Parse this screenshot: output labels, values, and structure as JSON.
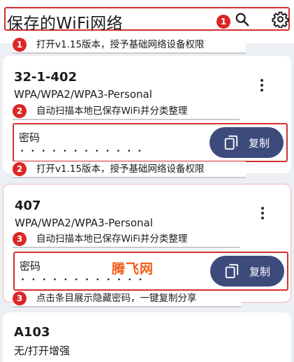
{
  "header": {
    "title": "保存的WiFi网络",
    "badge": "1",
    "search_icon": "search-icon",
    "settings_icon": "gear-icon"
  },
  "notes": [
    {
      "badge": "1",
      "text": "打开v1.15版本，授予基础网络设备权限"
    },
    {
      "badge": "2",
      "text": "自动扫描本地已保存WiFi并分类整理"
    },
    {
      "badge": "2",
      "text": "打开v1.15版本，授予基础网络设备权限"
    },
    {
      "badge": "3",
      "text": "自动扫描本地已保存WiFi并分类整理"
    },
    {
      "badge": "3",
      "text": "点击条目展示隐藏密码，一键复制分享"
    }
  ],
  "networks": [
    {
      "ssid": "32-1-402",
      "security": "WPA/WPA2/WPA3-Personal",
      "password_label": "密码",
      "password_mask": "••••••••••••",
      "copy_label": "复制"
    },
    {
      "ssid": "407",
      "security": "WPA/WPA2/WPA3-Personal",
      "password_label": "密码",
      "password_mask": "••••••••••••",
      "copy_label": "复制"
    },
    {
      "ssid": "A103",
      "security": "无/打开增强"
    }
  ],
  "watermark": "腾飞网",
  "colors": {
    "accent": "#3d4a7c",
    "badge": "#dc2626",
    "annotation_border": "#d32f2f",
    "watermark": "#f25c18"
  }
}
